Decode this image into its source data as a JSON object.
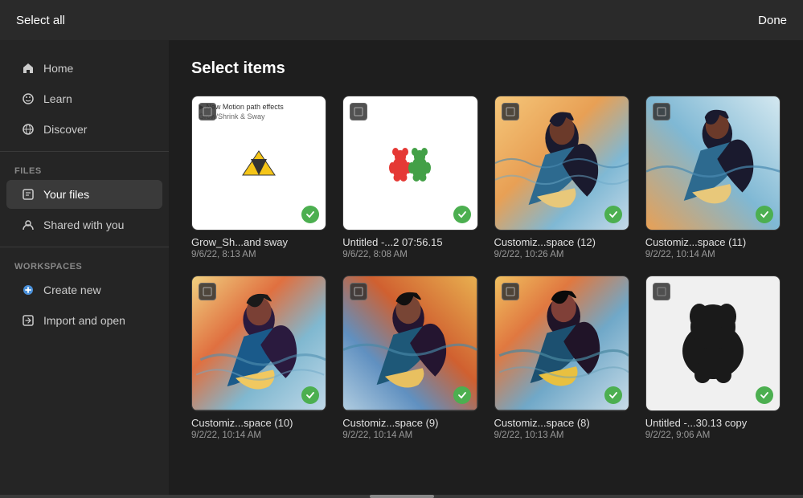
{
  "topbar": {
    "select_all_label": "Select all",
    "done_label": "Done"
  },
  "sidebar": {
    "nav_items": [
      {
        "id": "home",
        "label": "Home",
        "icon": "🏠"
      },
      {
        "id": "learn",
        "label": "Learn",
        "icon": "💡"
      },
      {
        "id": "discover",
        "label": "Discover",
        "icon": "🌐"
      }
    ],
    "files_section_label": "FILES",
    "files_items": [
      {
        "id": "your-files",
        "label": "Your files",
        "icon": "📄",
        "active": true
      },
      {
        "id": "shared",
        "label": "Shared with you",
        "icon": "👤"
      }
    ],
    "workspaces_section_label": "WORKSPACES",
    "workspace_items": [
      {
        "id": "create-new",
        "label": "Create new",
        "icon": "➕"
      },
      {
        "id": "import",
        "label": "Import and open",
        "icon": "📂"
      }
    ]
  },
  "content": {
    "title": "Select items",
    "files": [
      {
        "id": "file-1",
        "name": "Grow_Sh...and sway",
        "date": "9/6/22, 8:13 AM",
        "selected": true,
        "thumb_type": "motion_path"
      },
      {
        "id": "file-2",
        "name": "Untitled -...2 07:56.15",
        "date": "9/6/22, 8:08 AM",
        "selected": true,
        "thumb_type": "gummy_bear"
      },
      {
        "id": "file-3",
        "name": "Customiz...space (12)",
        "date": "9/2/22, 10:26 AM",
        "selected": true,
        "thumb_type": "skater_1"
      },
      {
        "id": "file-4",
        "name": "Customiz...space (11)",
        "date": "9/2/22, 10:14 AM",
        "selected": true,
        "thumb_type": "skater_2"
      },
      {
        "id": "file-5",
        "name": "Customiz...space (10)",
        "date": "9/2/22, 10:14 AM",
        "selected": true,
        "thumb_type": "skater_3"
      },
      {
        "id": "file-6",
        "name": "Customiz...space (9)",
        "date": "9/2/22, 10:14 AM",
        "selected": true,
        "thumb_type": "skater_4"
      },
      {
        "id": "file-7",
        "name": "Customiz...space (8)",
        "date": "9/2/22, 10:13 AM",
        "selected": true,
        "thumb_type": "skater_5"
      },
      {
        "id": "file-8",
        "name": "Untitled -...30.13 copy",
        "date": "9/2/22, 9:06 AM",
        "selected": true,
        "thumb_type": "blob"
      }
    ]
  }
}
